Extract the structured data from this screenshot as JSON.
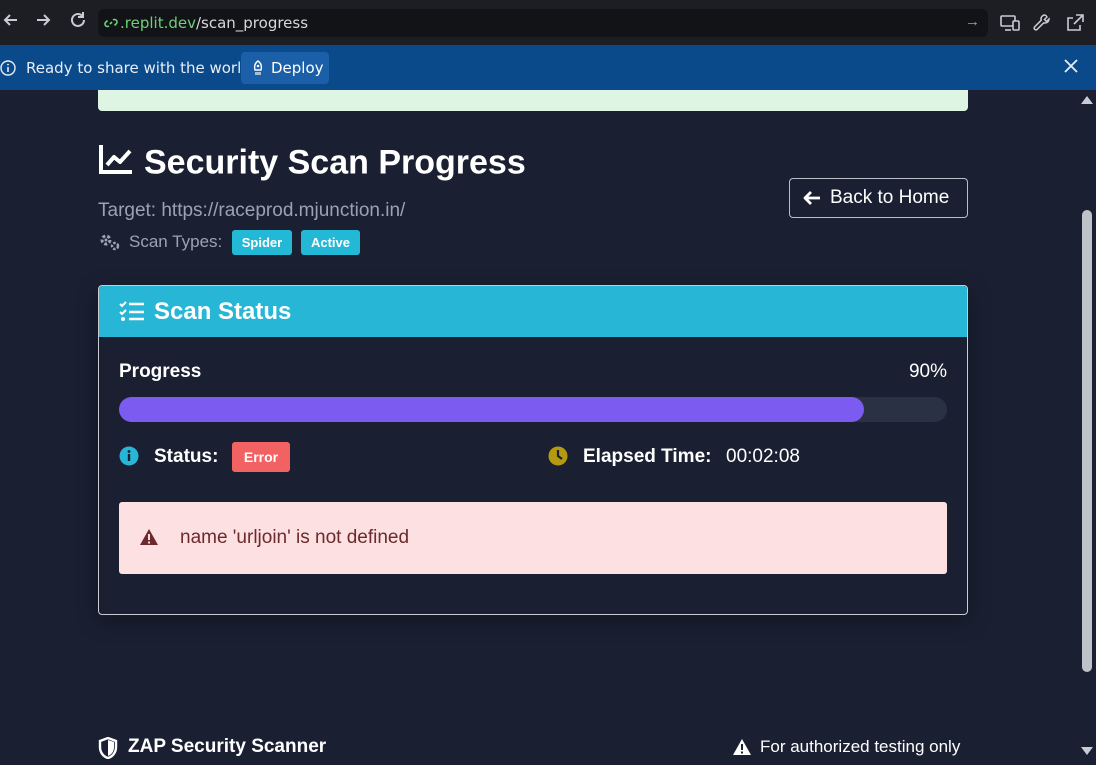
{
  "browser": {
    "url_host": ".replit.dev",
    "url_path": "/scan_progress"
  },
  "banner": {
    "message": "Ready to share with the world?",
    "deploy_label": "Deploy"
  },
  "page": {
    "title": "Security Scan Progress",
    "target": "Target: https://raceprod.mjunction.in/",
    "scan_types_label": "Scan Types:",
    "scan_types": [
      "Spider",
      "Active"
    ],
    "back_label": "Back to Home"
  },
  "card": {
    "header": "Scan Status",
    "progress_label": "Progress",
    "progress_percent_text": "90%",
    "progress_value": 0.9,
    "status_label": "Status:",
    "status_value": "Error",
    "elapsed_label": "Elapsed Time:",
    "elapsed_value": "00:02:08",
    "error_message": "name 'urljoin' is not defined"
  },
  "footer": {
    "brand": "ZAP Security Scanner",
    "notice": "For authorized testing only"
  },
  "colors": {
    "progress_fill": "#7c5cf0",
    "header_accent": "#27b6d6",
    "error": "#f26263"
  }
}
